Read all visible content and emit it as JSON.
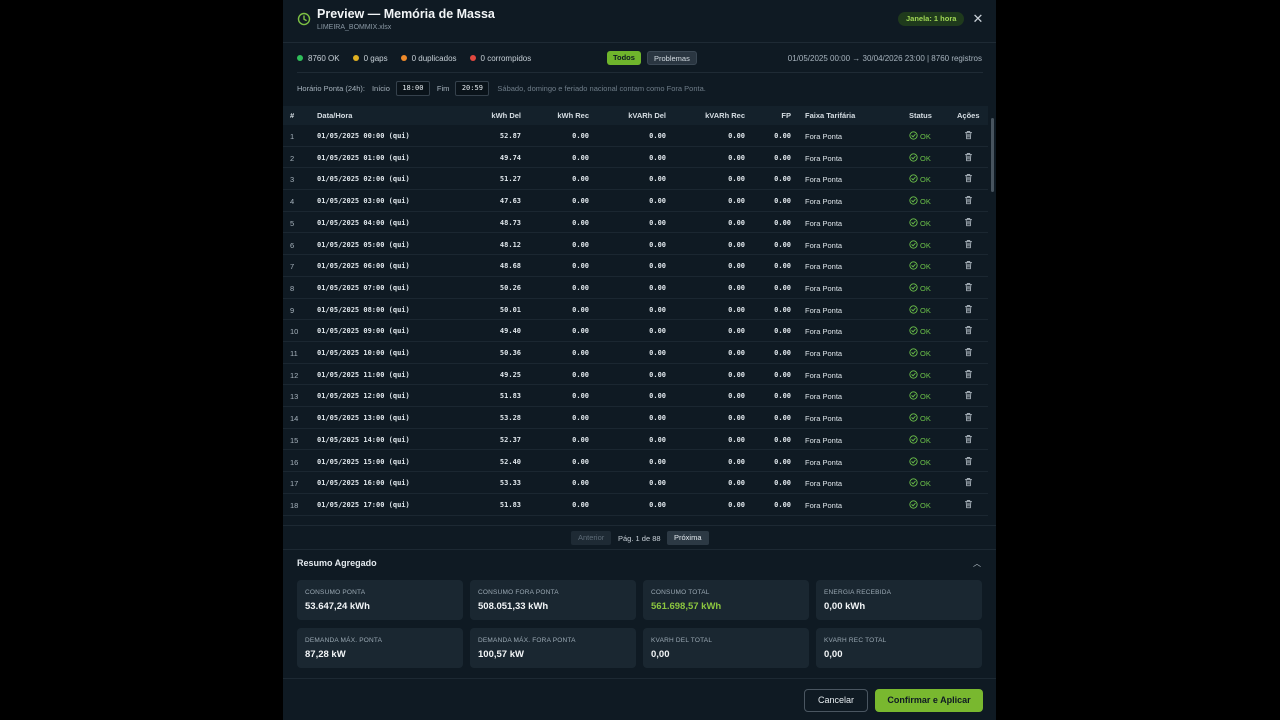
{
  "header": {
    "title": "Preview — Memória de Massa",
    "subtitle": "LIMEIRA_BOMMIX.xlsx",
    "window_badge": "Janela: 1 hora",
    "close_icon": "close-icon"
  },
  "stats": {
    "ok": "8760 OK",
    "gaps": "0 gaps",
    "duplicados": "0 duplicados",
    "corrompidos": "0 corrompidos",
    "colors": {
      "ok": "#2fbf5a",
      "gaps": "#e0b021",
      "duplicados": "#ef8a2a",
      "corrompidos": "#e2483f"
    }
  },
  "filters": {
    "all": "Todos",
    "problems": "Problemas",
    "active": "Todos"
  },
  "range": "01/05/2025 00:00 → 30/04/2026 23:00 | 8760 registros",
  "peak": {
    "label": "Horário Ponta (24h):",
    "start_label": "Início",
    "start_value": "18:00",
    "end_label": "Fim",
    "end_value": "20:59",
    "note": "Sábado, domingo e feriado nacional contam como Fora Ponta."
  },
  "table": {
    "columns": [
      "#",
      "Data/Hora",
      "kWh Del",
      "kWh Rec",
      "kVARh Del",
      "kVARh Rec",
      "FP",
      "Faixa Tarifária",
      "Status",
      "Ações"
    ],
    "rows": [
      [
        "1",
        "01/05/2025 00:00 (qui)",
        "52.87",
        "0.00",
        "0.00",
        "0.00",
        "0.00",
        "Fora Ponta",
        "OK"
      ],
      [
        "2",
        "01/05/2025 01:00 (qui)",
        "49.74",
        "0.00",
        "0.00",
        "0.00",
        "0.00",
        "Fora Ponta",
        "OK"
      ],
      [
        "3",
        "01/05/2025 02:00 (qui)",
        "51.27",
        "0.00",
        "0.00",
        "0.00",
        "0.00",
        "Fora Ponta",
        "OK"
      ],
      [
        "4",
        "01/05/2025 03:00 (qui)",
        "47.63",
        "0.00",
        "0.00",
        "0.00",
        "0.00",
        "Fora Ponta",
        "OK"
      ],
      [
        "5",
        "01/05/2025 04:00 (qui)",
        "48.73",
        "0.00",
        "0.00",
        "0.00",
        "0.00",
        "Fora Ponta",
        "OK"
      ],
      [
        "6",
        "01/05/2025 05:00 (qui)",
        "48.12",
        "0.00",
        "0.00",
        "0.00",
        "0.00",
        "Fora Ponta",
        "OK"
      ],
      [
        "7",
        "01/05/2025 06:00 (qui)",
        "48.68",
        "0.00",
        "0.00",
        "0.00",
        "0.00",
        "Fora Ponta",
        "OK"
      ],
      [
        "8",
        "01/05/2025 07:00 (qui)",
        "50.26",
        "0.00",
        "0.00",
        "0.00",
        "0.00",
        "Fora Ponta",
        "OK"
      ],
      [
        "9",
        "01/05/2025 08:00 (qui)",
        "50.01",
        "0.00",
        "0.00",
        "0.00",
        "0.00",
        "Fora Ponta",
        "OK"
      ],
      [
        "10",
        "01/05/2025 09:00 (qui)",
        "49.40",
        "0.00",
        "0.00",
        "0.00",
        "0.00",
        "Fora Ponta",
        "OK"
      ],
      [
        "11",
        "01/05/2025 10:00 (qui)",
        "50.36",
        "0.00",
        "0.00",
        "0.00",
        "0.00",
        "Fora Ponta",
        "OK"
      ],
      [
        "12",
        "01/05/2025 11:00 (qui)",
        "49.25",
        "0.00",
        "0.00",
        "0.00",
        "0.00",
        "Fora Ponta",
        "OK"
      ],
      [
        "13",
        "01/05/2025 12:00 (qui)",
        "51.83",
        "0.00",
        "0.00",
        "0.00",
        "0.00",
        "Fora Ponta",
        "OK"
      ],
      [
        "14",
        "01/05/2025 13:00 (qui)",
        "53.28",
        "0.00",
        "0.00",
        "0.00",
        "0.00",
        "Fora Ponta",
        "OK"
      ],
      [
        "15",
        "01/05/2025 14:00 (qui)",
        "52.37",
        "0.00",
        "0.00",
        "0.00",
        "0.00",
        "Fora Ponta",
        "OK"
      ],
      [
        "16",
        "01/05/2025 15:00 (qui)",
        "52.40",
        "0.00",
        "0.00",
        "0.00",
        "0.00",
        "Fora Ponta",
        "OK"
      ],
      [
        "17",
        "01/05/2025 16:00 (qui)",
        "53.33",
        "0.00",
        "0.00",
        "0.00",
        "0.00",
        "Fora Ponta",
        "OK"
      ],
      [
        "18",
        "01/05/2025 17:00 (qui)",
        "51.83",
        "0.00",
        "0.00",
        "0.00",
        "0.00",
        "Fora Ponta",
        "OK"
      ]
    ],
    "status_icon": "check-circle-icon",
    "action_icon": "trash-icon"
  },
  "pager": {
    "prev": "Anterior",
    "info": "Pág. 1 de 88",
    "next": "Próxima"
  },
  "summary": {
    "title": "Resumo Agregado",
    "toggle_icon": "chevron-up-icon",
    "cards": [
      {
        "label": "CONSUMO PONTA",
        "value": "53.647,24 kWh"
      },
      {
        "label": "CONSUMO FORA PONTA",
        "value": "508.051,33 kWh"
      },
      {
        "label": "CONSUMO TOTAL",
        "value": "561.698,57 kWh",
        "highlight": true
      },
      {
        "label": "ENERGIA RECEBIDA",
        "value": "0,00 kWh"
      },
      {
        "label": "DEMANDA MÁX. PONTA",
        "value": "87,28 kW"
      },
      {
        "label": "DEMANDA MÁX. FORA PONTA",
        "value": "100,57 kW"
      },
      {
        "label": "KVARH DEL TOTAL",
        "value": "0,00"
      },
      {
        "label": "KVARH REC TOTAL",
        "value": "0,00"
      }
    ]
  },
  "footer": {
    "cancel": "Cancelar",
    "confirm": "Confirmar e Aplicar"
  },
  "colors": {
    "accent": "#79b82f",
    "background": "#0f1a23"
  }
}
